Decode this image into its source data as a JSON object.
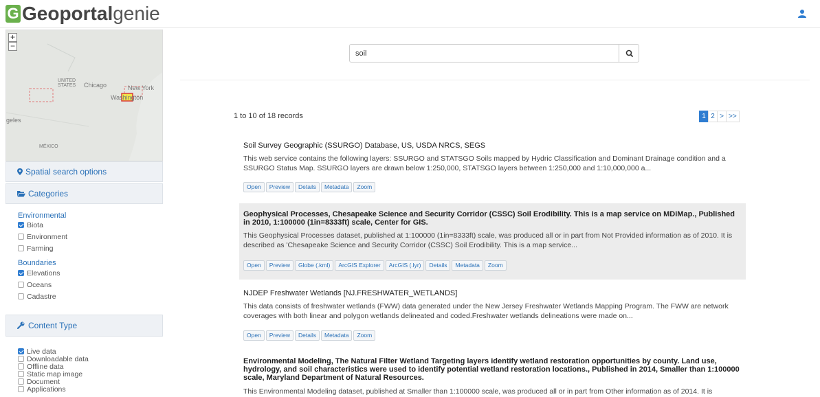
{
  "header": {
    "logo_brand": "Geoportal",
    "logo_product": "genie",
    "user_icon": "user-icon"
  },
  "map": {
    "zoom_in": "+",
    "zoom_out": "−",
    "labels": [
      "UNITED STATES",
      "Chicago",
      "New York",
      "Washington",
      "geles",
      "MÉXICO"
    ]
  },
  "sidebar": {
    "spatial_label": "Spatial search options",
    "categories_label": "Categories",
    "groups": [
      {
        "name": "Environmental",
        "items": [
          {
            "label": "Biota",
            "checked": true
          },
          {
            "label": "Environment",
            "checked": false
          },
          {
            "label": "Farming",
            "checked": false
          }
        ]
      },
      {
        "name": "Boundaries",
        "items": [
          {
            "label": "Elevations",
            "checked": true
          },
          {
            "label": "Oceans",
            "checked": false
          },
          {
            "label": "Cadastre",
            "checked": false
          }
        ]
      }
    ],
    "content_type_label": "Content Type",
    "content_types": [
      {
        "label": "Live data",
        "checked": true
      },
      {
        "label": "Downloadable data",
        "checked": false
      },
      {
        "label": "Offline data",
        "checked": false
      },
      {
        "label": "Static map image",
        "checked": false
      },
      {
        "label": "Document",
        "checked": false
      },
      {
        "label": "Applications",
        "checked": false
      }
    ]
  },
  "search": {
    "value": "soil",
    "icon": "search-icon"
  },
  "results": {
    "count_text": "1 to 10 of 18 records",
    "pages": [
      "1",
      "2",
      ">",
      ">>"
    ],
    "items": [
      {
        "title": "Soil Survey Geographic (SSURGO) Database, US, USDA NRCS, SEGS",
        "desc": "This web service contains the following layers: SSURGO and STATSGO Soils mapped by Hydric Classification and Dominant Drainage condition and a SSURGO Status Map. SSURGO layers are drawn below 1:250,000, STATSGO layers between 1:250,000 and 1:10,000,000 a...",
        "buttons": [
          "Open",
          "Preview",
          "Details",
          "Metadata",
          "Zoom"
        ]
      },
      {
        "title": "Geophysical Processes, Chesapeake Science and Security Corridor (CSSC) Soil Erodibility. This is a map service on MDiMap., Published in 2010, 1:100000 (1in=8333ft) scale, Center for GIS.",
        "desc": "This Geophysical Processes dataset, published at 1:100000 (1in=8333ft) scale, was produced all or in part from Not Provided information as of 2010. It is described as 'Chesapeake Science and Security Corridor (CSSC) Soil Erodibility. This is a map service...",
        "buttons": [
          "Open",
          "Preview",
          "Globe (.kml)",
          "ArcGIS Explorer",
          "ArcGIS (.lyr)",
          "Details",
          "Metadata",
          "Zoom"
        ]
      },
      {
        "title": "NJDEP Freshwater Wetlands [NJ.FRESHWATER_WETLANDS]",
        "desc": "This data consists of freshwater wetlands (FWW) data generated under the New Jersey Freshwater Wetlands Mapping Program. The FWW are network coverages with both linear and polygon wetlands delineated and coded.Freshwater wetlands delineations were made on...",
        "buttons": [
          "Open",
          "Preview",
          "Details",
          "Metadata",
          "Zoom"
        ]
      },
      {
        "title": "Environmental Modeling, The Natural Filter Wetland Targeting layers identify wetland restoration opportunities by county. Land use, hydrology, and soil characteristics were used to identify potential wetland restoration locations., Published in 2014, Smaller than 1:100000 scale, Maryland Department of Natural Resources.",
        "desc": "This Environmental Modeling dataset, published at Smaller than 1:100000 scale, was produced all or in part from Other information as of 2014. It is",
        "buttons": []
      }
    ]
  }
}
